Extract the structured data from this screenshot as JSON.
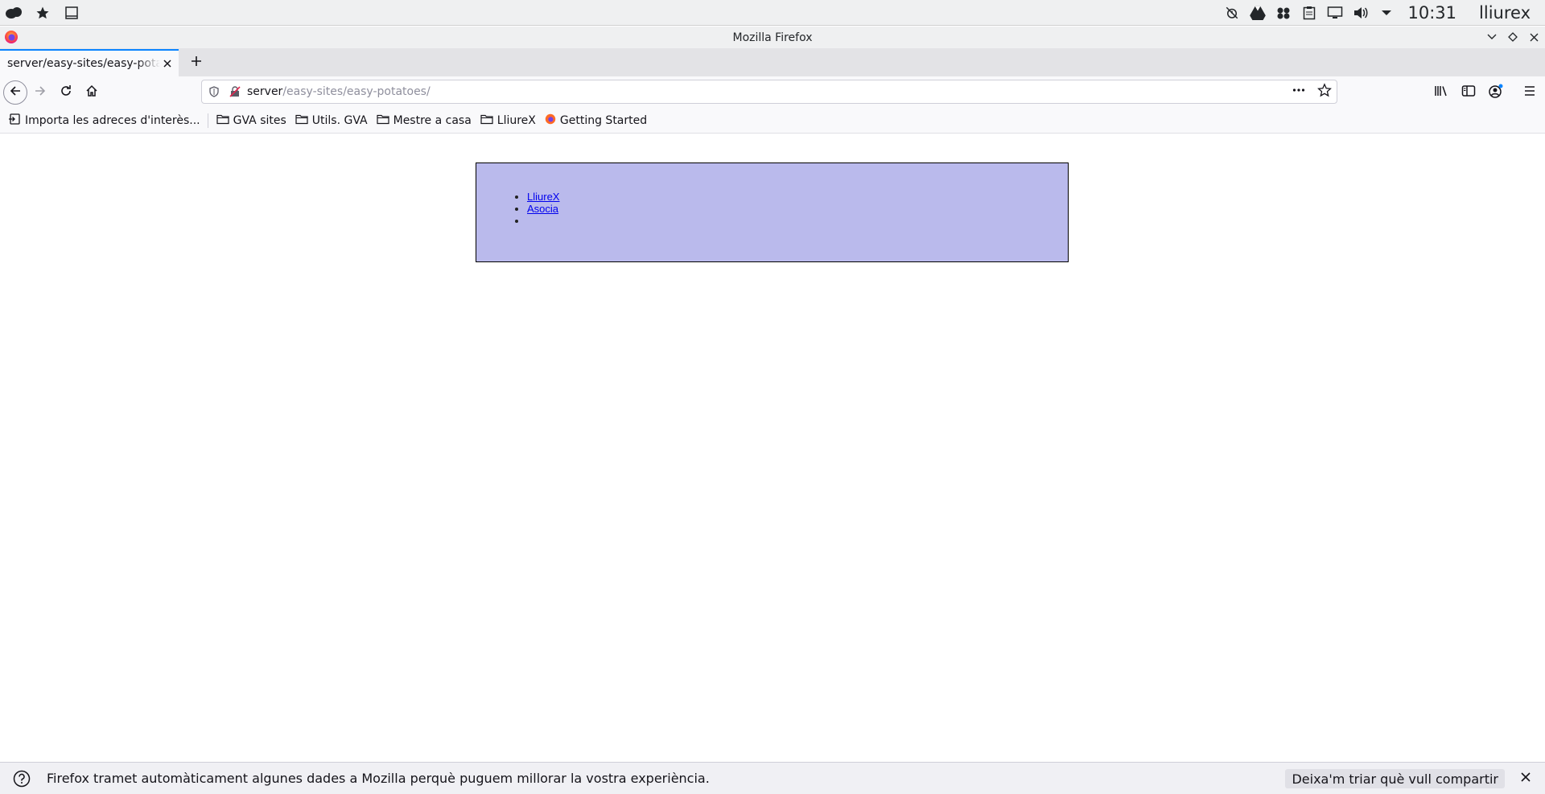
{
  "system_panel": {
    "clock": "10:31",
    "user": "lliurex",
    "left_icons": [
      "app-launcher-icon",
      "favorites-star-icon",
      "window-icon"
    ],
    "right_icons": [
      "alarm-off-icon",
      "google-drive-icon",
      "network-cluster-icon",
      "clipboard-icon",
      "display-icon",
      "volume-icon",
      "tray-expand-icon"
    ]
  },
  "window": {
    "title": "Mozilla Firefox"
  },
  "tab": {
    "title": "server/easy-sites/easy-potatoes/"
  },
  "urlbar": {
    "host": "server",
    "path": "/easy-sites/easy-potatoes/"
  },
  "bookmarks": {
    "import": "Importa les adreces d'interès...",
    "items": [
      "GVA sites",
      "Utils. GVA",
      "Mestre a casa",
      "LliureX",
      "Getting Started"
    ]
  },
  "page": {
    "links": [
      "LliureX ",
      "Asocia "
    ],
    "box_color": "#babaec"
  },
  "notification": {
    "text": "Firefox tramet automàticament algunes dades a Mozilla perquè puguem millorar la vostra experiència.",
    "button": "Deixa'm triar què vull compartir"
  },
  "colors": {
    "accent": "#0a84ff",
    "link": "#0000ee"
  }
}
